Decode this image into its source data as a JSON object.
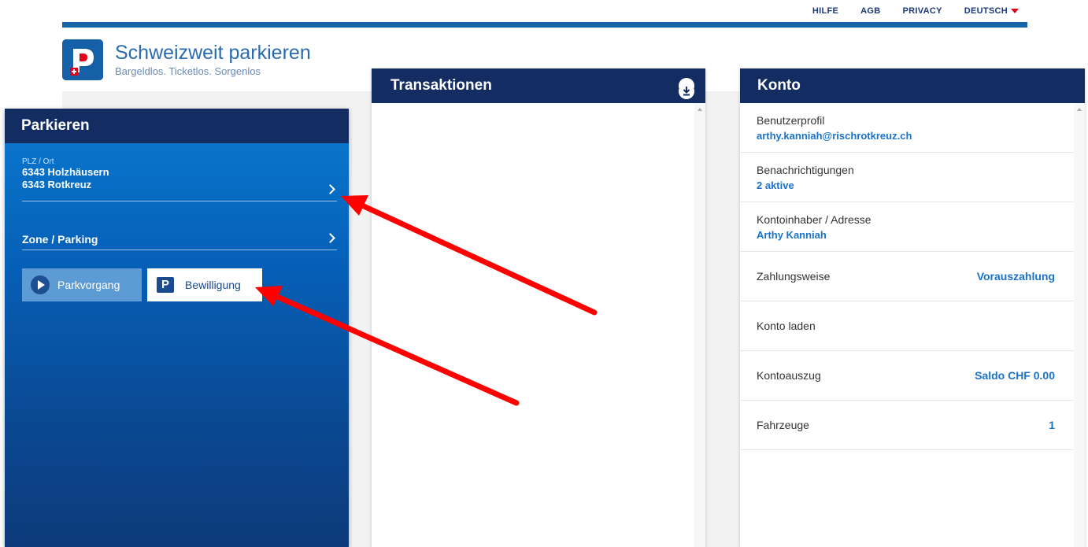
{
  "topnav": {
    "help": "HILFE",
    "terms": "AGB",
    "privacy": "PRIVACY",
    "language": "DEUTSCH"
  },
  "brand": {
    "title": "Schweizweit parkieren",
    "subtitle": "Bargeldlos. Ticketlos. Sorgenlos"
  },
  "transactions": {
    "title": "Transaktionen",
    "download_icon": "download-icon"
  },
  "account": {
    "title": "Konto",
    "rows": [
      {
        "label": "Benutzerprofil",
        "sub": "arthy.kanniah@rischrotkreuz.ch",
        "value": ""
      },
      {
        "label": "Benachrichtigungen",
        "sub": "2 aktive",
        "value": ""
      },
      {
        "label": "Kontoinhaber / Adresse",
        "sub": "Arthy Kanniah",
        "value": ""
      },
      {
        "label": "Zahlungsweise",
        "sub": "",
        "value": "Vorauszahlung"
      },
      {
        "label": "Konto laden",
        "sub": "",
        "value": ""
      },
      {
        "label": "Kontoauszug",
        "sub": "",
        "value": "Saldo CHF 0.00"
      },
      {
        "label": "Fahrzeuge",
        "sub": "",
        "value": "1"
      }
    ]
  },
  "parking": {
    "title": "Parkieren",
    "location_label": "PLZ / Ort",
    "location_values": [
      "6343 Holzhäusern",
      "6343 Rotkreuz"
    ],
    "zone_label": "Zone / Parking",
    "start_button": "Parkvorgang",
    "permit_badge": "P",
    "permit_button": "Bewilligung"
  },
  "colors": {
    "brand_blue": "#132d63",
    "accent_red": "#e2001a",
    "link_blue": "#1a73c8"
  }
}
